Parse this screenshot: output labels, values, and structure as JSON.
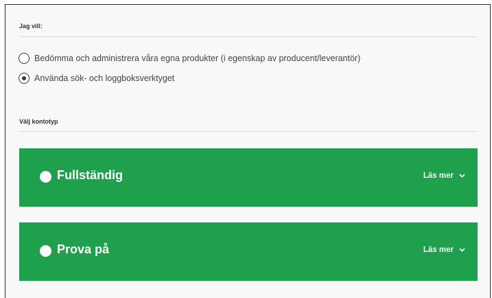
{
  "sections": {
    "intent_label": "Jag vill:",
    "account_type_label": "Välj kontotyp"
  },
  "intent_options": [
    {
      "label": "Bedömma och administrera våra egna produkter (i egenskap av producent/leverantör)",
      "selected": false
    },
    {
      "label": "Använda sök- och loggboksverktyget",
      "selected": true
    }
  ],
  "account_types": [
    {
      "title": "Fullständig",
      "read_more": "Läs mer",
      "selected": false
    },
    {
      "title": "Prova på",
      "read_more": "Läs mer",
      "selected": false
    }
  ],
  "colors": {
    "accent_green": "#1fa04d",
    "background": "#f8f8f8"
  },
  "icons": {
    "read_more": "chevron-down-icon",
    "option": "radio-icon"
  }
}
